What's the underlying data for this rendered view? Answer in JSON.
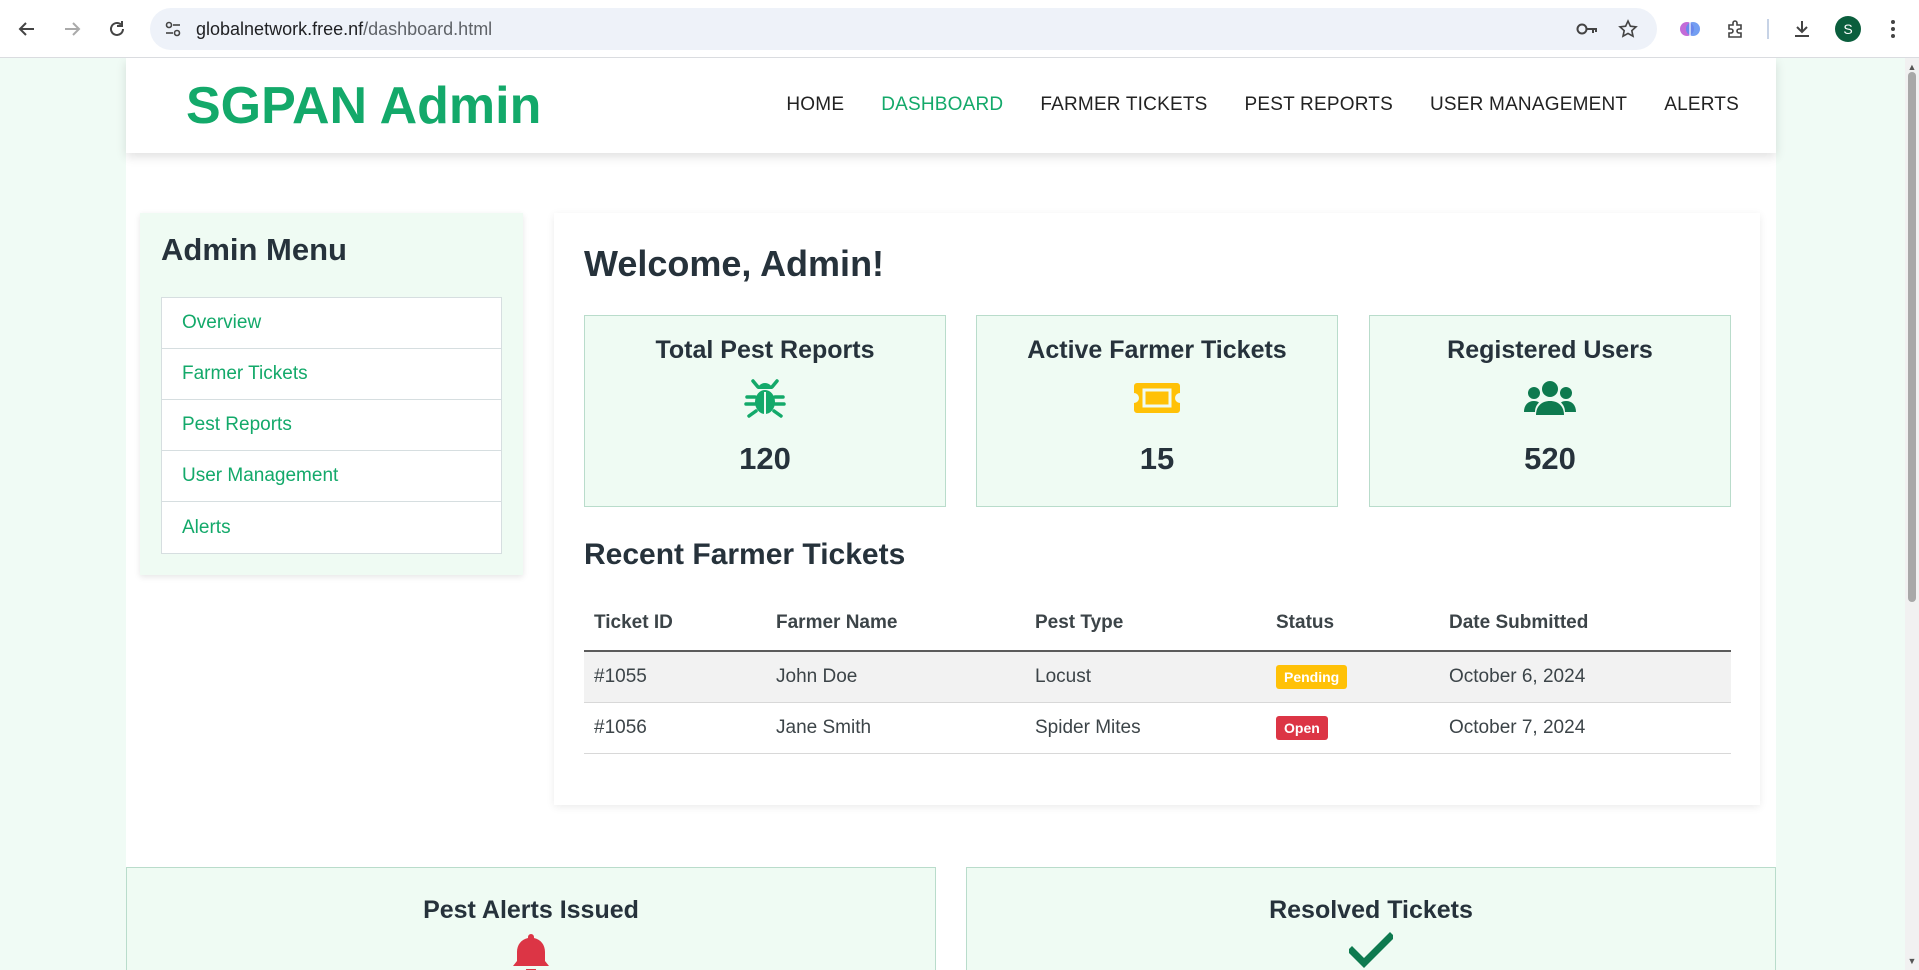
{
  "browser": {
    "url_domain": "globalnetwork.free.nf",
    "url_path": "/dashboard.html",
    "profile_initial": "S"
  },
  "header": {
    "brand": "SGPAN Admin",
    "nav": [
      {
        "label": "HOME",
        "active": false
      },
      {
        "label": "DASHBOARD",
        "active": true
      },
      {
        "label": "FARMER TICKETS",
        "active": false
      },
      {
        "label": "PEST REPORTS",
        "active": false
      },
      {
        "label": "USER MANAGEMENT",
        "active": false
      },
      {
        "label": "ALERTS",
        "active": false
      }
    ]
  },
  "sidebar": {
    "title": "Admin Menu",
    "items": [
      {
        "label": "Overview"
      },
      {
        "label": "Farmer Tickets"
      },
      {
        "label": "Pest Reports"
      },
      {
        "label": "User Management"
      },
      {
        "label": "Alerts"
      }
    ]
  },
  "main": {
    "welcome": "Welcome, Admin!",
    "stats": [
      {
        "title": "Total Pest Reports",
        "icon": "bug-icon",
        "value": "120",
        "color": "#13a96a"
      },
      {
        "title": "Active Farmer Tickets",
        "icon": "ticket-icon",
        "value": "15",
        "color": "#ffc107"
      },
      {
        "title": "Registered Users",
        "icon": "users-icon",
        "value": "520",
        "color": "#0e7a4f"
      }
    ],
    "tickets_title": "Recent Farmer Tickets",
    "table": {
      "headers": [
        "Ticket ID",
        "Farmer Name",
        "Pest Type",
        "Status",
        "Date Submitted"
      ],
      "rows": [
        {
          "id": "#1055",
          "farmer": "John Doe",
          "pest": "Locust",
          "status": "Pending",
          "date": "October 6, 2024"
        },
        {
          "id": "#1056",
          "farmer": "Jane Smith",
          "pest": "Spider Mites",
          "status": "Open",
          "date": "October 7, 2024"
        }
      ]
    }
  },
  "bottom_cards": [
    {
      "title": "Pest Alerts Issued",
      "icon": "bell-icon",
      "color": "#dc3545"
    },
    {
      "title": "Resolved Tickets",
      "icon": "check-icon",
      "color": "#0e7a4f"
    }
  ],
  "colors": {
    "accent": "#13a96a",
    "card_bg": "#effbf3",
    "pending": "#ffc107",
    "open": "#dc3545"
  }
}
